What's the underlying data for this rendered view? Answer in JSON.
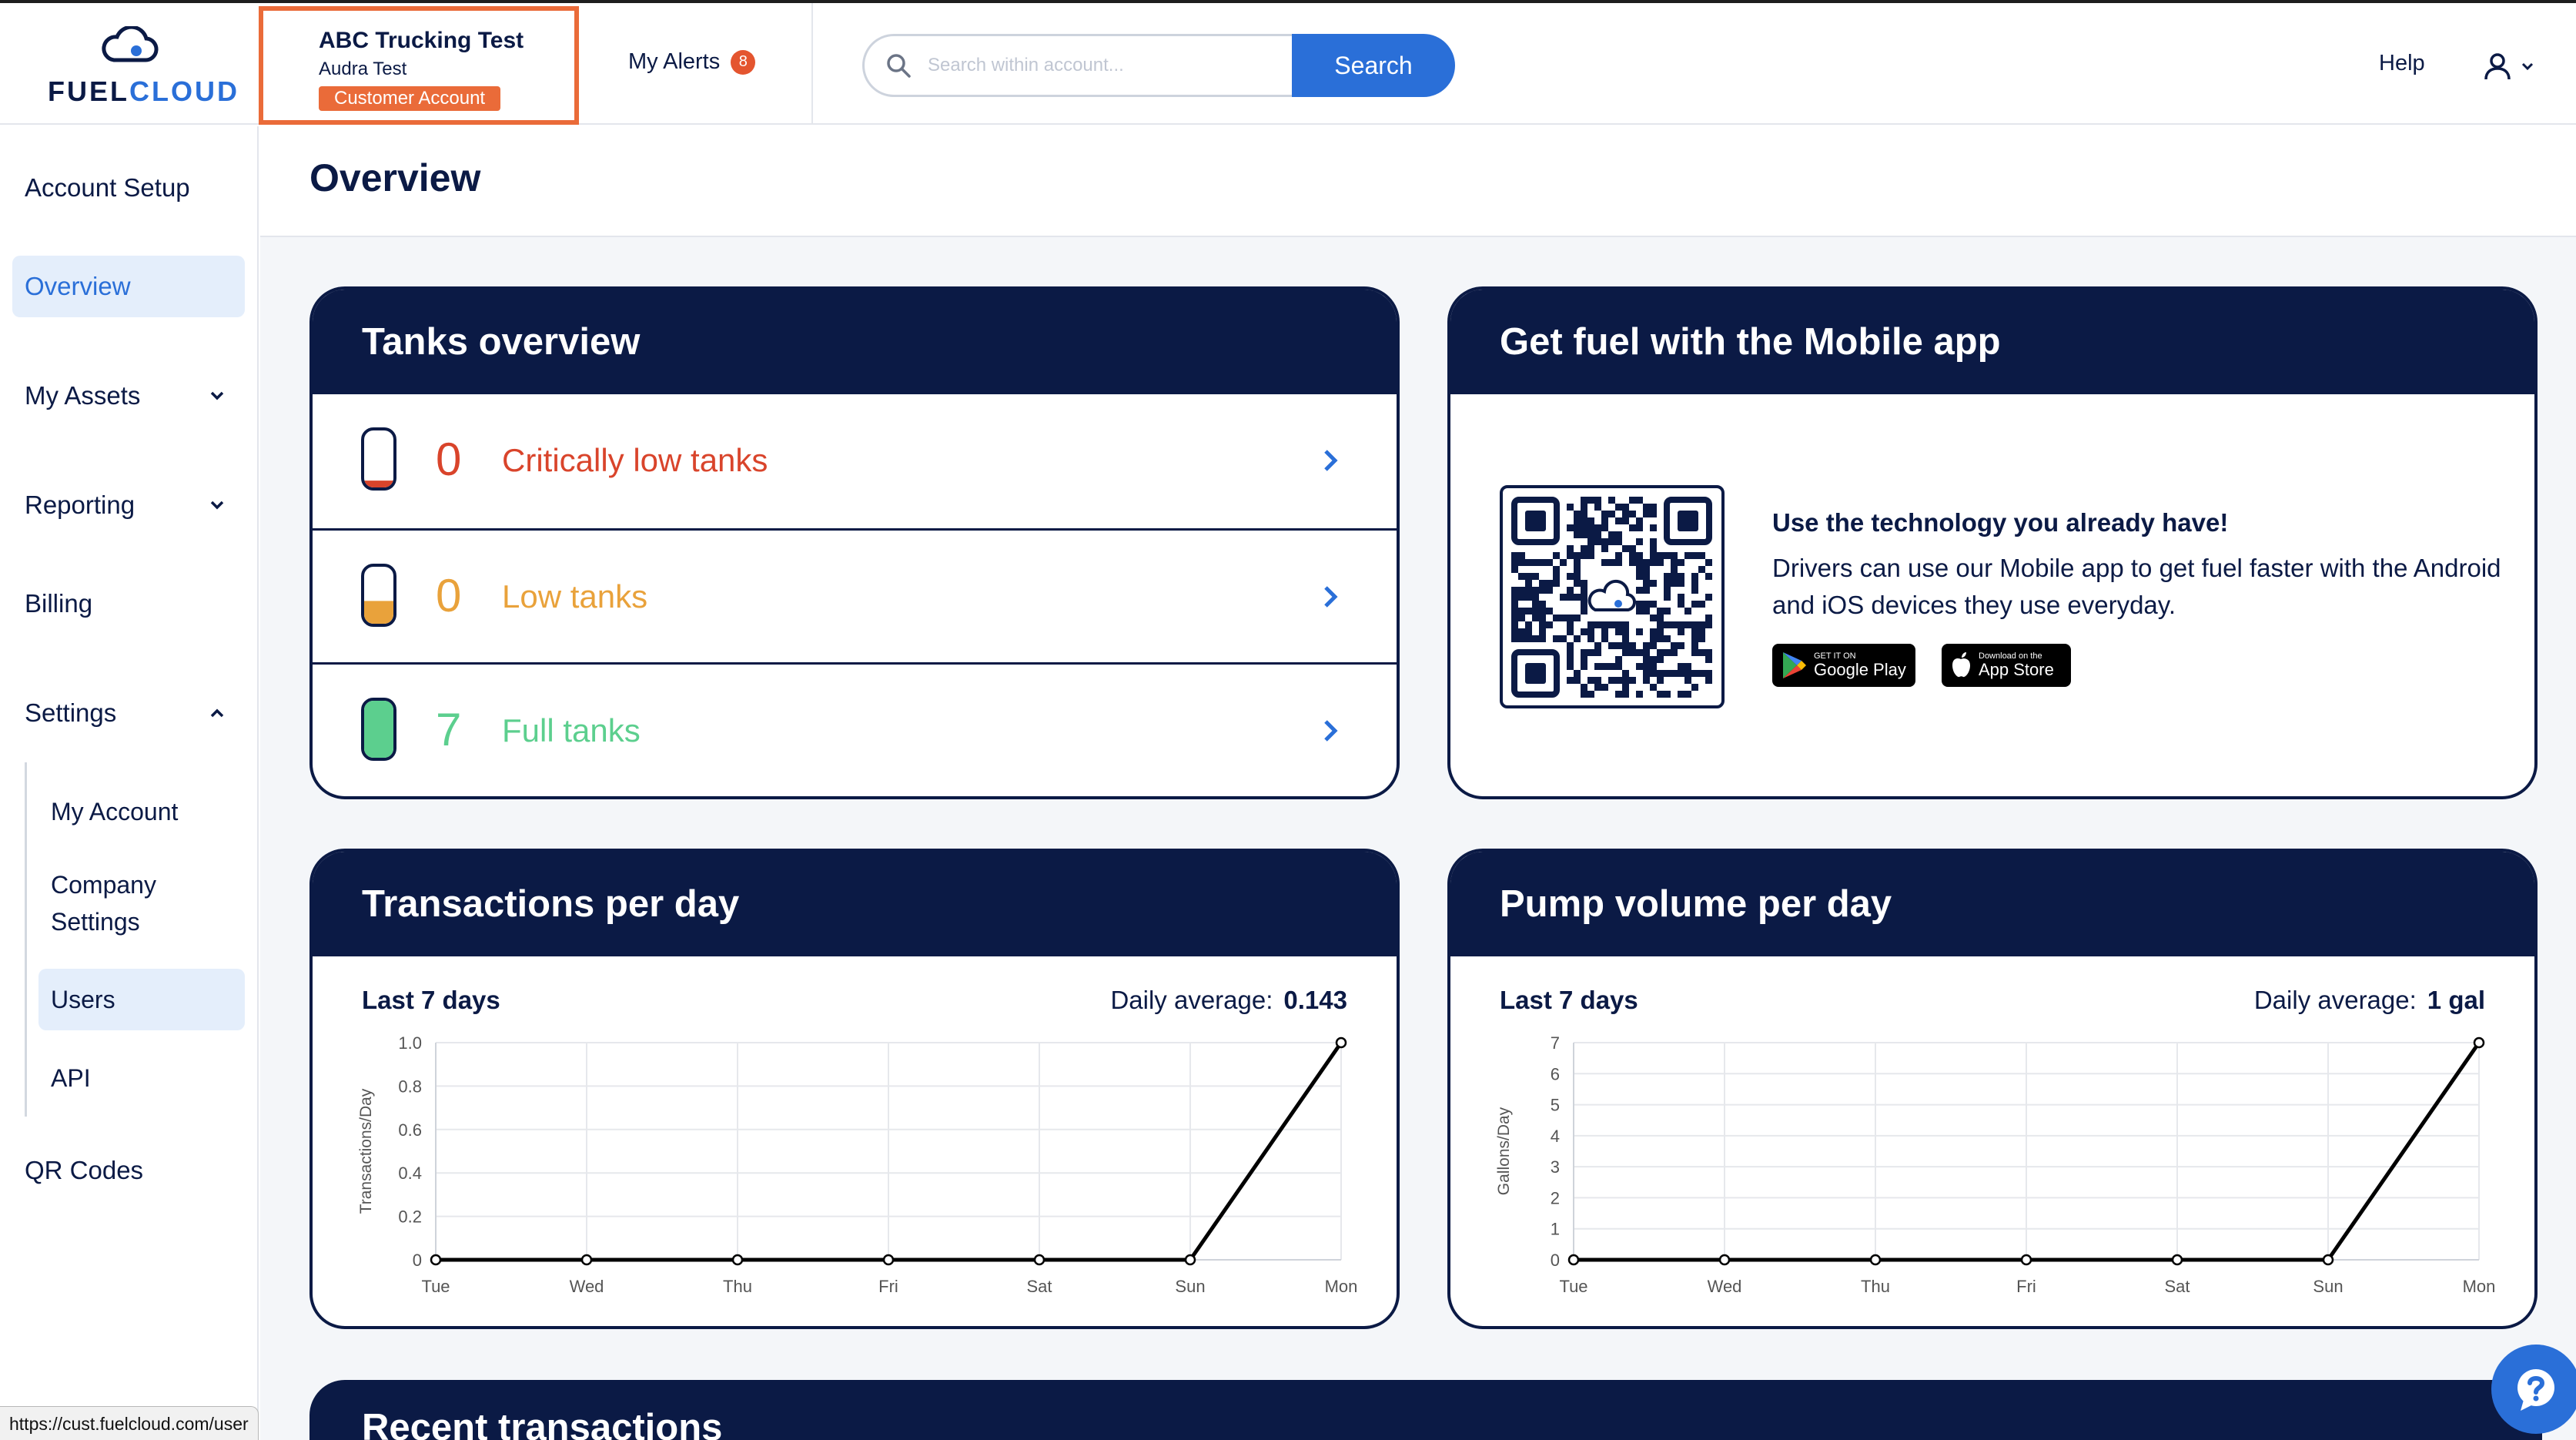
{
  "brand": {
    "name_part1": "FUEL",
    "name_part2": "CLOUD",
    "blue": "#2a6fd8",
    "navy": "#0b1a45",
    "orange": "#ea6b39"
  },
  "account": {
    "name": "ABC Trucking Test",
    "user": "Audra Test",
    "badge": "Customer Account"
  },
  "alerts": {
    "label": "My Alerts",
    "count": "8"
  },
  "search": {
    "placeholder": "Search within account...",
    "button": "Search"
  },
  "header_right": {
    "help": "Help"
  },
  "sidebar": {
    "items": [
      {
        "label": "Account Setup"
      },
      {
        "label": "Overview"
      },
      {
        "label": "My Assets"
      },
      {
        "label": "Reporting"
      },
      {
        "label": "Billing"
      },
      {
        "label": "Settings"
      },
      {
        "label": "QR Codes"
      }
    ],
    "settings_sub": [
      {
        "label": "My Account"
      },
      {
        "label": "Company Settings"
      },
      {
        "label": "Users"
      },
      {
        "label": "API"
      }
    ]
  },
  "page": {
    "title": "Overview"
  },
  "tanks": {
    "title": "Tanks overview",
    "rows": [
      {
        "count": "0",
        "label": "Critically low tanks",
        "color": "#d9442b",
        "fill": 0.12
      },
      {
        "count": "0",
        "label": "Low tanks",
        "color": "#e9a23b",
        "fill": 0.4
      },
      {
        "count": "7",
        "label": "Full tanks",
        "color": "#5ccf8e",
        "fill": 1.0
      }
    ]
  },
  "mobile": {
    "title": "Get fuel with the Mobile app",
    "headline": "Use the technology you already have!",
    "desc": "Drivers can use our Mobile app to get fuel faster with the Android and iOS devices they use everyday.",
    "google_small": "GET IT ON",
    "google_big": "Google Play",
    "apple_small": "Download on the",
    "apple_big": "App Store"
  },
  "transactions": {
    "title": "Transactions per day",
    "period": "Last 7 days",
    "avg_label": "Daily average:",
    "avg_value": "0.143"
  },
  "pump": {
    "title": "Pump volume per day",
    "period": "Last 7 days",
    "avg_label": "Daily average:",
    "avg_value": "1 gal"
  },
  "recent": {
    "title": "Recent transactions"
  },
  "status_url": "https://cust.fuelcloud.com/user",
  "chart_data": [
    {
      "type": "line",
      "categories": [
        "Tue",
        "Wed",
        "Thu",
        "Fri",
        "Sat",
        "Sun",
        "Mon"
      ],
      "values": [
        0,
        0,
        0,
        0,
        0,
        0,
        1
      ],
      "ylabel": "Transactions/Day",
      "ylim": [
        0,
        1.0
      ],
      "yticks": [
        "0",
        "0.2",
        "0.4",
        "0.6",
        "0.8",
        "1.0"
      ],
      "grid": true
    },
    {
      "type": "line",
      "categories": [
        "Tue",
        "Wed",
        "Thu",
        "Fri",
        "Sat",
        "Sun",
        "Mon"
      ],
      "values": [
        0,
        0,
        0,
        0,
        0,
        0,
        7
      ],
      "ylabel": "Gallons/Day",
      "ylim": [
        0,
        7
      ],
      "yticks": [
        "0",
        "1",
        "2",
        "3",
        "4",
        "5",
        "6",
        "7"
      ],
      "grid": true
    }
  ]
}
